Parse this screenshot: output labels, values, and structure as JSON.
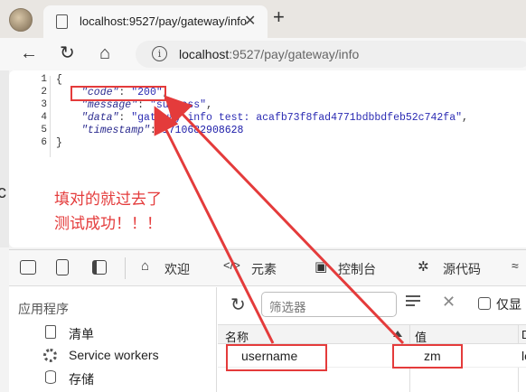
{
  "tab": {
    "title": "localhost:9527/pay/gateway/info",
    "close": "✕",
    "new_tab": "+"
  },
  "toolbar": {
    "back": "←",
    "reload": "↻",
    "home": "⌂",
    "info": "i",
    "url_host": "localhost",
    "url_rest": ":9527/pay/gateway/info"
  },
  "json": {
    "line_numbers": [
      "1",
      "2",
      "3",
      "4",
      "5",
      "6"
    ],
    "open": "{",
    "close": "}",
    "code_key": "\"code\"",
    "code_val": "\"200\"",
    "message_key": "\"message\"",
    "message_val": "\"success\"",
    "data_key": "\"data\"",
    "data_val": "\"gateway info test: acafb73f8fad4771bdbbdfeb52c742fa\"",
    "timestamp_key": "\"timestamp\"",
    "timestamp_val": "1710682908628"
  },
  "annotation": {
    "line1": "填对的就过去了",
    "line2": "测试成功！！！"
  },
  "devtools": {
    "tabs": {
      "welcome": "欢迎",
      "elements": "元素",
      "console": "控制台",
      "sources": "源代码"
    },
    "icons": {
      "welcome": "⌂",
      "elements": "</>",
      "console": "▣",
      "sources": "✲"
    },
    "app_heading": "应用程序",
    "tree": {
      "manifest": "清单",
      "service_workers": "Service workers",
      "storage": "存储"
    },
    "filter_placeholder": "筛选器",
    "only_show": "仅显",
    "table": {
      "col_name": "名称",
      "col_value": "值",
      "col_third": "D",
      "row_name": "username",
      "row_value": "zm",
      "row_third": "lo"
    }
  },
  "colors": {
    "highlight": "#e43b3b"
  }
}
